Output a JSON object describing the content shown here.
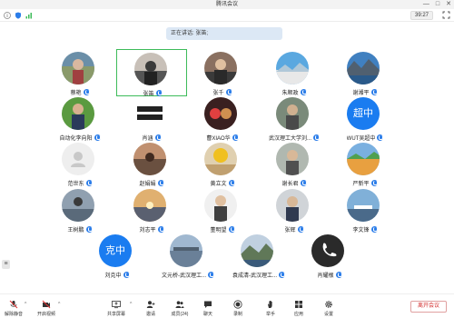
{
  "window": {
    "title": "腾讯会议",
    "minimize": "—",
    "maximize": "□",
    "close": "✕"
  },
  "status": {
    "timer": "39:27"
  },
  "speaking": {
    "text": "正在讲话: 张笛;"
  },
  "participants": [
    {
      "name": "蔡艳",
      "avatar": "photo"
    },
    {
      "name": "张笛",
      "avatar": "photo",
      "active": true
    },
    {
      "name": "张千",
      "avatar": "photo"
    },
    {
      "name": "朱顺政",
      "avatar": "photo"
    },
    {
      "name": "谢湘平",
      "avatar": "photo"
    },
    {
      "name": "自动化李向阳",
      "avatar": "photo"
    },
    {
      "name": "肖涵",
      "avatar": "photo"
    },
    {
      "name": "曹XIAO华",
      "avatar": "photo"
    },
    {
      "name": "武汉理工大学刘...",
      "avatar": "photo"
    },
    {
      "name": "WUT吴超中",
      "avatar": "text",
      "avatar_text": "超中"
    },
    {
      "name": "范世东",
      "avatar": "default"
    },
    {
      "name": "赵娟娟",
      "avatar": "photo"
    },
    {
      "name": "黄立文",
      "avatar": "photo"
    },
    {
      "name": "谢长君",
      "avatar": "photo"
    },
    {
      "name": "严新平",
      "avatar": "photo"
    },
    {
      "name": "王树鹏",
      "avatar": "photo"
    },
    {
      "name": "刘志平",
      "avatar": "photo"
    },
    {
      "name": "董明望",
      "avatar": "photo"
    },
    {
      "name": "张辉",
      "avatar": "photo"
    },
    {
      "name": "李文锋",
      "avatar": "photo"
    },
    {
      "name": "刘克中",
      "avatar": "text",
      "avatar_text": "克中"
    },
    {
      "name": "文元桥-武汉理工...",
      "avatar": "photo"
    },
    {
      "name": "袁成清-武汉理工...",
      "avatar": "photo"
    },
    {
      "name": "肖耀根",
      "avatar": "photo"
    }
  ],
  "toolbar": {
    "mute": "解除静音",
    "video": "开启视频",
    "share": "共享屏幕",
    "invite": "邀请",
    "members": "成员(24)",
    "chat": "聊天",
    "record": "录制",
    "hand": "举手",
    "apps": "应用",
    "settings": "设置",
    "leave": "离开会议"
  }
}
